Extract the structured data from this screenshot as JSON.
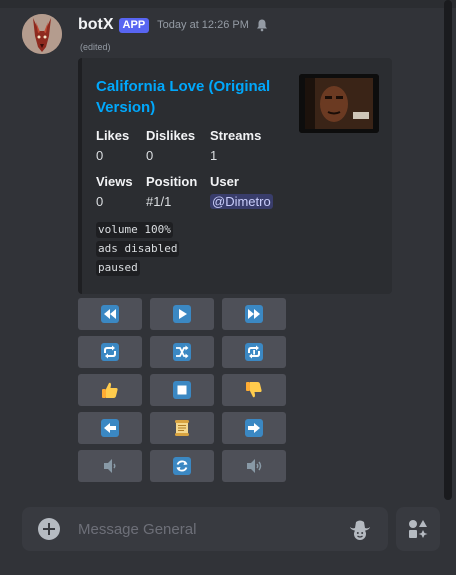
{
  "message": {
    "username": "botX",
    "badge": "APP",
    "timestamp": "Today at 12:26 PM",
    "edited": "(edited)",
    "avatar_icon": "red-fox-avatar"
  },
  "embed": {
    "title": "California Love (Original Version)",
    "accent_color": "#1e1f22",
    "thumbnail_icon": "album-cover-thumbnail",
    "fields": {
      "likes": {
        "name": "Likes",
        "value": "0"
      },
      "dislikes": {
        "name": "Dislikes",
        "value": "0"
      },
      "streams": {
        "name": "Streams",
        "value": "1"
      },
      "views": {
        "name": "Views",
        "value": "0"
      },
      "position": {
        "name": "Position",
        "value": "#1/1"
      },
      "user": {
        "name": "User",
        "value": "@Dimetro"
      }
    },
    "code_lines": [
      "volume 100%",
      "ads disabled",
      "paused"
    ]
  },
  "controls": {
    "rows": [
      [
        "rewind-icon",
        "play-icon",
        "fast-forward-icon"
      ],
      [
        "repeat-icon",
        "shuffle-icon",
        "repeat-one-icon"
      ],
      [
        "thumbs-up-icon",
        "stop-icon",
        "thumbs-down-icon"
      ],
      [
        "arrow-left-icon",
        "scroll-icon",
        "arrow-right-icon"
      ],
      [
        "volume-down-icon",
        "refresh-icon",
        "volume-up-icon"
      ]
    ]
  },
  "composer": {
    "placeholder": "Message General"
  },
  "colors": {
    "background": "#313338",
    "embed_bg": "#2b2d31",
    "link": "#00a8fc",
    "badge": "#5865f2",
    "button": "#4e5058",
    "button_icon_blue": "#3b88c3",
    "thumb_yellow": "#ffcc4d"
  }
}
